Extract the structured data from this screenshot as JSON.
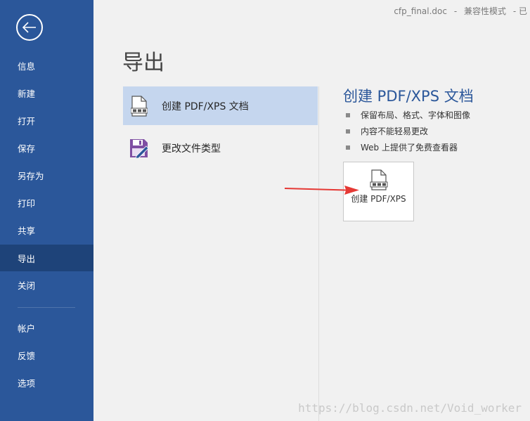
{
  "window": {
    "filename": "cfp_final.doc",
    "separator": "-",
    "mode": "兼容性模式",
    "truncated": "-  已"
  },
  "sidebar": {
    "back_icon": "back-arrow-icon",
    "items": [
      {
        "label": "信息"
      },
      {
        "label": "新建"
      },
      {
        "label": "打开"
      },
      {
        "label": "保存"
      },
      {
        "label": "另存为"
      },
      {
        "label": "打印"
      },
      {
        "label": "共享"
      },
      {
        "label": "导出",
        "active": true
      },
      {
        "label": "关闭"
      },
      {
        "label": "帐户"
      },
      {
        "label": "反馈"
      },
      {
        "label": "选项"
      }
    ]
  },
  "main": {
    "title": "导出",
    "options": [
      {
        "label": "创建 PDF/XPS 文档",
        "icon": "pdf-document-icon",
        "selected": true
      },
      {
        "label": "更改文件类型",
        "icon": "save-file-type-icon",
        "selected": false
      }
    ]
  },
  "detail": {
    "title": "创建 PDF/XPS 文档",
    "bullets": [
      "保留布局、格式、字体和图像",
      "内容不能轻易更改",
      "Web 上提供了免费查看器"
    ],
    "button_label": "创建 PDF/XPS",
    "button_icon": "pdf-document-icon"
  },
  "annotation": {
    "arrow_color": "#e53935"
  },
  "watermark": "https://blog.csdn.net/Void_worker",
  "colors": {
    "accent": "#2b579a",
    "accent_dark": "#1e4379",
    "selected": "#c5d6ee"
  }
}
